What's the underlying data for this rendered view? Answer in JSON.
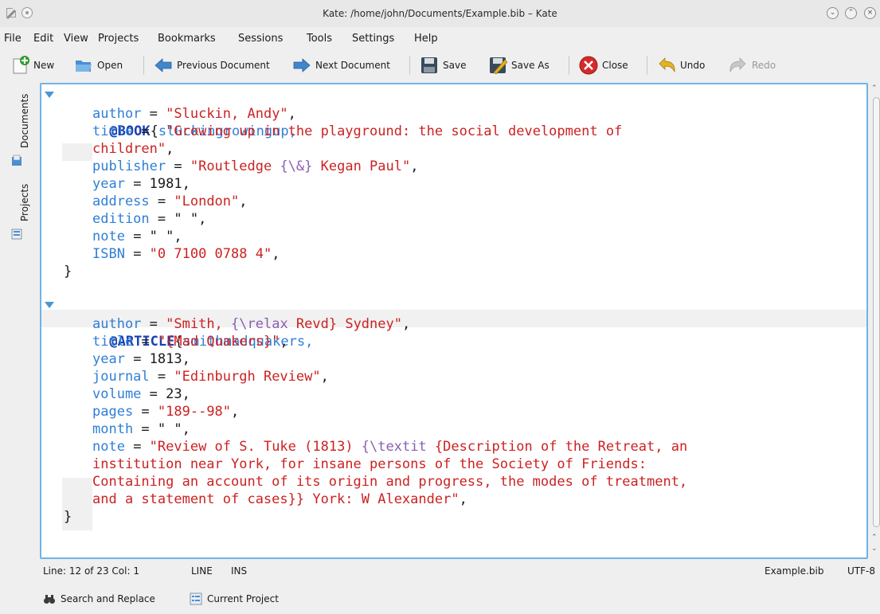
{
  "window": {
    "title": "Kate: /home/john/Documents/Example.bib – Kate"
  },
  "menu": [
    "File",
    "Edit",
    "View",
    "Projects",
    "Bookmarks",
    "Sessions",
    "Tools",
    "Settings",
    "Help"
  ],
  "toolbar": {
    "new": "New",
    "open": "Open",
    "previous": "Previous Document",
    "next": "Next Document",
    "save": "Save",
    "save_as": "Save As",
    "close": "Close",
    "undo": "Undo",
    "redo": "Redo"
  },
  "sidebar": {
    "documents": "Documents",
    "projects": "Projects"
  },
  "code": {
    "book_type": "@BOOK",
    "book_key": "sluckingrowingup,",
    "book_author_field": "author",
    "book_author_value": "\"Sluckin, Andy\"",
    "book_title_field": "title",
    "book_title_value_1": "\"Growing up in the playground: the social development of",
    "book_title_value_2": "children\"",
    "book_publisher_field": "publisher",
    "book_publisher_value_a": "\"Routledge ",
    "book_publisher_value_cmd": "{\\&}",
    "book_publisher_value_b": " Kegan Paul\"",
    "book_year_field": "year",
    "book_year_value": "1981",
    "book_address_field": "address",
    "book_address_value": "\"London\"",
    "book_edition_field": "edition",
    "book_edition_value": "\" \"",
    "book_note_field": "note",
    "book_note_value": "\" \"",
    "book_isbn_field": "ISBN",
    "book_isbn_value": "\"0 7100 0788 4\"",
    "close_brace": "}",
    "article_type": "@ARTICLE",
    "article_key": "smithmadquakers,",
    "article_author_field": "author",
    "article_author_value_a": "\"Smith, ",
    "article_author_value_cmd": "{\\relax",
    "article_author_value_b": " Revd} Sydney\"",
    "article_title_field": "title",
    "article_title_value": "\"{Mad Quakers}\"",
    "article_year_field": "year",
    "article_year_value": "1813",
    "article_journal_field": "journal",
    "article_journal_value": "\"Edinburgh Review\"",
    "article_volume_field": "volume",
    "article_volume_value": "23",
    "article_pages_field": "pages",
    "article_pages_value": "\"189--98\"",
    "article_month_field": "month",
    "article_month_value": "\" \"",
    "article_note_field": "note",
    "article_note_value_a": "\"Review of S. Tuke (1813) ",
    "article_note_value_cmd": "{\\textit",
    "article_note_value_b": " {Description of the Retreat, an",
    "article_note_value_2": "institution near York, for insane persons of the Society of Friends:",
    "article_note_value_3": "Containing an account of its origin and progress, the modes of treatment,",
    "article_note_value_4": "and a statement of cases}} York: W Alexander\""
  },
  "status": {
    "position": "Line: 12 of 23 Col: 1",
    "mode": "LINE",
    "insert": "INS",
    "filename": "Example.bib",
    "encoding": "UTF-8"
  },
  "bottom": {
    "search": "Search and Replace",
    "project": "Current Project"
  },
  "colors": {
    "keyword": "#1a3fb0",
    "field": "#2f7fd6",
    "string": "#cc2222",
    "command": "#8a5fb0",
    "focus_border": "#6fb4e6"
  }
}
